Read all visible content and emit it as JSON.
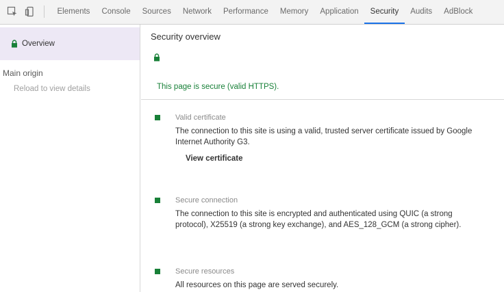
{
  "toolbar": {
    "icons": [
      "inspect-icon",
      "device-toolbar-icon"
    ],
    "tabs": [
      {
        "label": "Elements"
      },
      {
        "label": "Console"
      },
      {
        "label": "Sources"
      },
      {
        "label": "Network"
      },
      {
        "label": "Performance"
      },
      {
        "label": "Memory"
      },
      {
        "label": "Application"
      },
      {
        "label": "Security",
        "active": true
      },
      {
        "label": "Audits"
      },
      {
        "label": "AdBlock"
      }
    ]
  },
  "sidebar": {
    "overview_label": "Overview",
    "main_origin_heading": "Main origin",
    "main_origin_sub": "Reload to view details"
  },
  "main": {
    "title": "Security overview",
    "status": "This page is secure (valid HTTPS).",
    "details": [
      {
        "title": "Valid certificate",
        "description": "The connection to this site is using a valid, trusted server certificate issued by Google Internet Authority G3.",
        "action": "View certificate"
      },
      {
        "title": "Secure connection",
        "description": "The connection to this site is encrypted and authenticated using QUIC (a strong protocol), X25519 (a strong key exchange), and AES_128_GCM (a strong cipher)."
      },
      {
        "title": "Secure resources",
        "description": "All resources on this page are served securely."
      }
    ]
  },
  "colors": {
    "secure_green": "#188038",
    "active_tab_underline": "#1a73e8",
    "sidebar_selected_bg": "#ede8f5"
  }
}
